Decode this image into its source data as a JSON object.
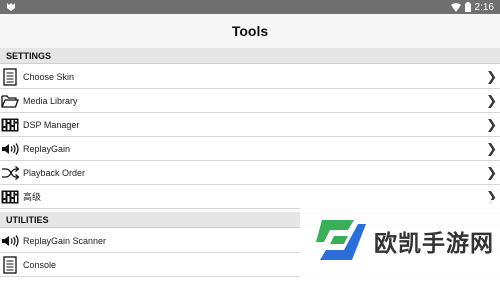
{
  "status_bar": {
    "time": "2:16",
    "icons": [
      "app-logo-icon",
      "wifi-icon",
      "battery-icon"
    ]
  },
  "header": {
    "title": "Tools"
  },
  "sections": [
    {
      "title": "SETTINGS",
      "items": [
        {
          "label": "Choose Skin",
          "icon": "clipboard-icon"
        },
        {
          "label": "Media Library",
          "icon": "folder-icon"
        },
        {
          "label": "DSP Manager",
          "icon": "equalizer-icon"
        },
        {
          "label": "ReplayGain",
          "icon": "speaker-icon"
        },
        {
          "label": "Playback Order",
          "icon": "shuffle-icon"
        },
        {
          "label": "高级",
          "icon": "equalizer-icon"
        }
      ]
    },
    {
      "title": "UTILITIES",
      "items": [
        {
          "label": "ReplayGain Scanner",
          "icon": "speaker-icon"
        },
        {
          "label": "Console",
          "icon": "clipboard-icon"
        }
      ]
    }
  ],
  "chevron": "❯",
  "watermark": {
    "text": "欧凯手游网"
  },
  "colors": {
    "status_bar": "#6f6f6f",
    "section_header": "#e6e6e6",
    "divider": "#d8d8d8",
    "watermark_green": "#3cae5a",
    "watermark_blue": "#2a6fd6"
  }
}
